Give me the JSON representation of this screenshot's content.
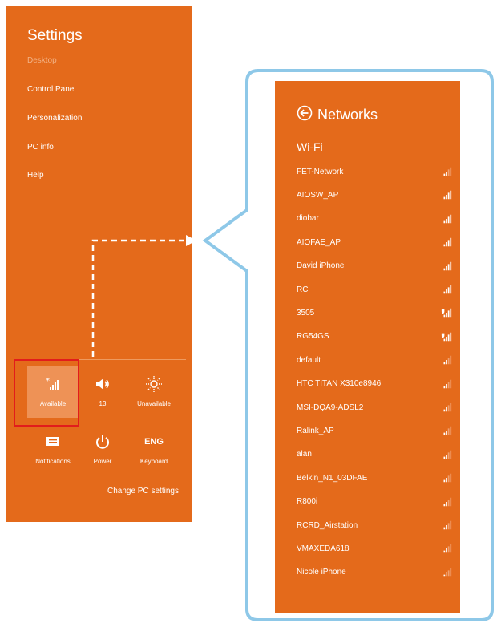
{
  "settings": {
    "title": "Settings",
    "items": [
      {
        "label": "Desktop",
        "dim": true
      },
      {
        "label": "Control Panel"
      },
      {
        "label": "Personalization"
      },
      {
        "label": "PC info"
      },
      {
        "label": "Help"
      }
    ],
    "quick_tiles": [
      {
        "label": "Available",
        "icon": "wifi-signal-icon"
      },
      {
        "label": "13",
        "icon": "volume-icon"
      },
      {
        "label": "Unavailable",
        "icon": "brightness-icon"
      },
      {
        "label": "Notifications",
        "icon": "notifications-icon"
      },
      {
        "label": "Power",
        "icon": "power-icon"
      },
      {
        "label": "Keyboard",
        "icon": "keyboard-icon",
        "text_icon": "ENG"
      }
    ],
    "change_pc_settings": "Change PC settings"
  },
  "networks": {
    "title": "Networks",
    "section": "Wi-Fi",
    "list": [
      {
        "name": "FET-Network",
        "strength": 0.4
      },
      {
        "name": "AIOSW_AP",
        "strength": 1
      },
      {
        "name": "diobar",
        "strength": 1
      },
      {
        "name": "AIOFAE_AP",
        "strength": 1
      },
      {
        "name": "David iPhone",
        "strength": 1
      },
      {
        "name": "RC",
        "strength": 1
      },
      {
        "name": "3505",
        "strength": 1,
        "secured": true
      },
      {
        "name": "RG54GS",
        "strength": 1,
        "secured": true
      },
      {
        "name": "default",
        "strength": 0.6
      },
      {
        "name": "HTC TITAN X310e8946",
        "strength": 0.6
      },
      {
        "name": "MSI-DQA9-ADSL2",
        "strength": 0.6
      },
      {
        "name": "Ralink_AP",
        "strength": 0.6
      },
      {
        "name": "alan",
        "strength": 0.4
      },
      {
        "name": "Belkin_N1_03DFAE",
        "strength": 0.4
      },
      {
        "name": "R800i",
        "strength": 0.6
      },
      {
        "name": "RCRD_Airstation",
        "strength": 0.4
      },
      {
        "name": "VMAXEDA618",
        "strength": 0.4
      },
      {
        "name": "Nicole iPhone",
        "strength": 0.2
      }
    ]
  },
  "colors": {
    "accent": "#e46a1b",
    "callout_border": "#8ec8e8",
    "highlight": "#e21c1c"
  }
}
